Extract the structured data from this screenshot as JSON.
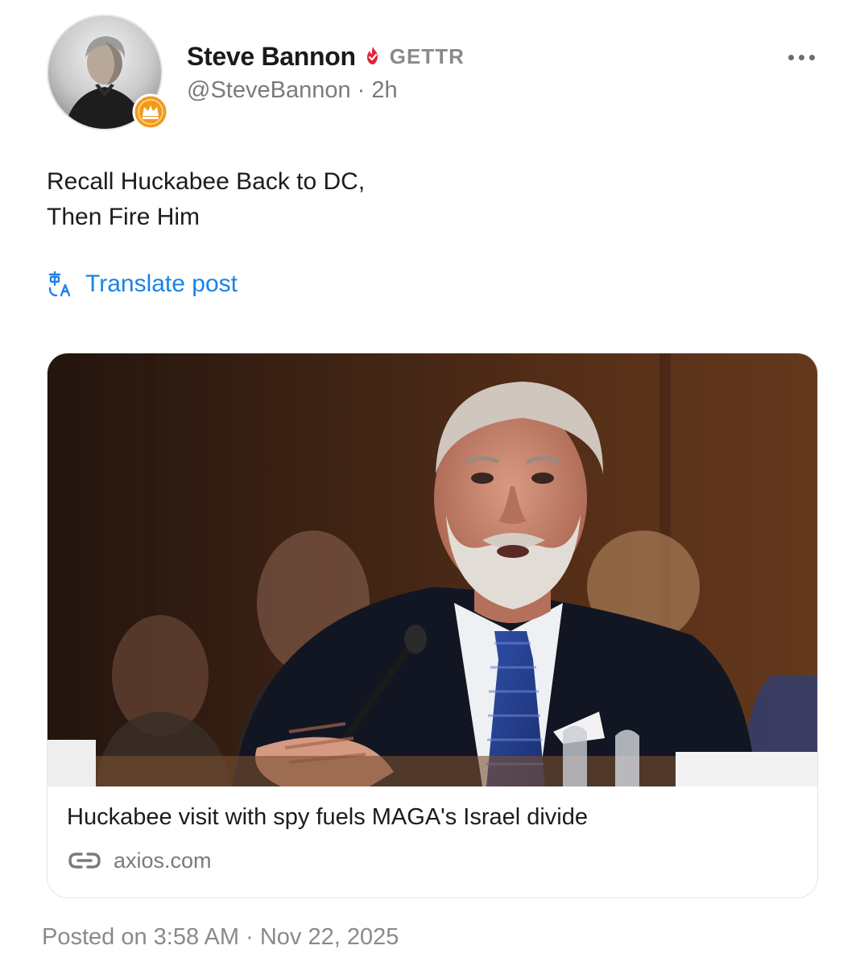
{
  "author": {
    "name": "Steve Bannon",
    "platform": "GETTR",
    "handle": "@SteveBannon",
    "time_ago": "2h",
    "handle_line": "@SteveBannon · 2h",
    "verified_icon": "verified-flame-icon",
    "badge_icon": "crown-badge-icon",
    "avatar_icon": "avatar"
  },
  "post": {
    "lines": [
      "Recall Huckabee Back to DC,",
      "Then Fire Him"
    ]
  },
  "translate": {
    "icon": "translate-icon",
    "label": "Translate post"
  },
  "more_menu": {
    "icon": "more-dots-icon"
  },
  "link_card": {
    "image_icon": "news-photo",
    "title": "Huckabee visit with spy fuels MAGA's Israel divide",
    "domain": "axios.com",
    "link_icon": "link-icon"
  },
  "footer": {
    "posted_on": "Posted on 3:58 AM · Nov 22, 2025"
  },
  "colors": {
    "accent_blue": "#1c82e6",
    "verified_red": "#e8213b",
    "badge_orange": "#f29a1c",
    "muted_gray": "#8a8a8a"
  }
}
